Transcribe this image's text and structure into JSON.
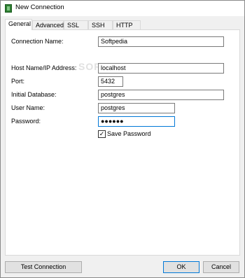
{
  "window": {
    "title": "New Connection",
    "icon": "app-elephant-icon"
  },
  "tabs": [
    {
      "label": "General",
      "active": true
    },
    {
      "label": "Advanced",
      "active": false
    },
    {
      "label": "SSL",
      "active": false
    },
    {
      "label": "SSH",
      "active": false
    },
    {
      "label": "HTTP",
      "active": false
    }
  ],
  "form": {
    "connection_name": {
      "label": "Connection Name:",
      "value": "Softpedia"
    },
    "host": {
      "label": "Host Name/IP Address:",
      "value": "localhost"
    },
    "port": {
      "label": "Port:",
      "value": "5432"
    },
    "initial_database": {
      "label": "Initial Database:",
      "value": "postgres"
    },
    "user_name": {
      "label": "User Name:",
      "value": "postgres"
    },
    "password": {
      "label": "Password:",
      "value": "●●●●●●"
    },
    "save_password": {
      "label": "Save Password",
      "checked": true,
      "mark": "✓"
    }
  },
  "watermark": "SOFTPEDIA",
  "buttons": {
    "test_connection": "Test Connection",
    "ok": "OK",
    "cancel": "Cancel"
  }
}
